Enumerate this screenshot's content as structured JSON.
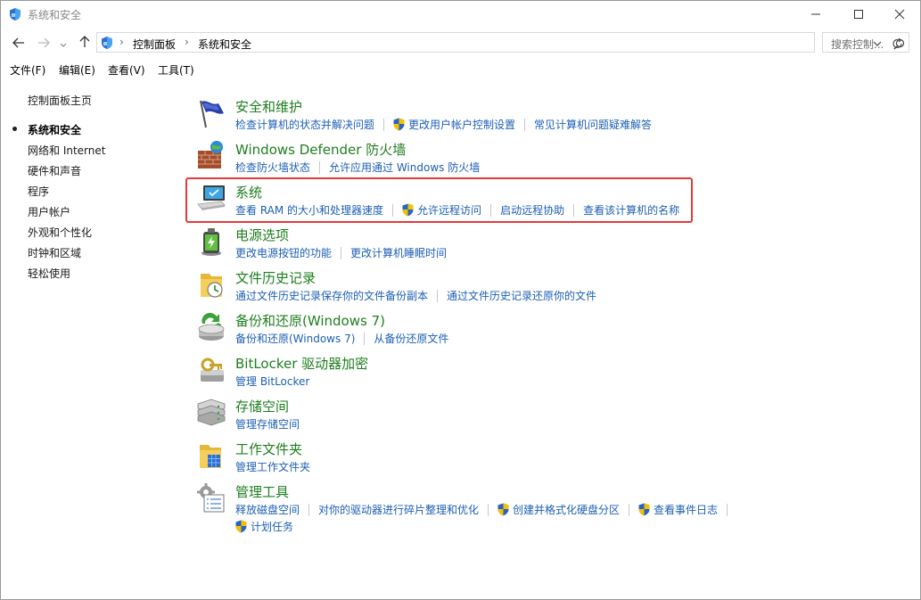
{
  "window": {
    "title": "系统和安全",
    "minimize_icon": "minimize-icon",
    "maximize_icon": "maximize-icon",
    "close_icon": "close-icon"
  },
  "address_bar": {
    "crumbs": [
      "控制面板",
      "系统和安全"
    ],
    "search_placeholder": "搜索控制..."
  },
  "menu": [
    {
      "label": "文件(F)"
    },
    {
      "label": "编辑(E)"
    },
    {
      "label": "查看(V)"
    },
    {
      "label": "工具(T)"
    }
  ],
  "sidebar": {
    "home": "控制面板主页",
    "items": [
      {
        "label": "系统和安全",
        "current": true
      },
      {
        "label": "网络和 Internet"
      },
      {
        "label": "硬件和声音"
      },
      {
        "label": "程序"
      },
      {
        "label": "用户帐户"
      },
      {
        "label": "外观和个性化"
      },
      {
        "label": "时钟和区域"
      },
      {
        "label": "轻松使用"
      }
    ]
  },
  "categories": [
    {
      "title": "安全和维护",
      "icon": "flag-icon",
      "links": [
        {
          "label": "检查计算机的状态并解决问题"
        },
        {
          "label": "更改用户帐户控制设置",
          "shield": true
        },
        {
          "label": "常见计算机问题疑难解答"
        }
      ]
    },
    {
      "title": "Windows Defender 防火墙",
      "icon": "firewall-icon",
      "links": [
        {
          "label": "检查防火墙状态"
        },
        {
          "label": "允许应用通过 Windows 防火墙"
        }
      ]
    },
    {
      "title": "系统",
      "icon": "system-computer-icon",
      "links": [
        {
          "label": "查看 RAM 的大小和处理器速度"
        },
        {
          "label": "允许远程访问",
          "shield": true
        },
        {
          "label": "启动远程协助"
        },
        {
          "label": "查看该计算机的名称"
        }
      ]
    },
    {
      "title": "电源选项",
      "icon": "battery-icon",
      "links": [
        {
          "label": "更改电源按钮的功能"
        },
        {
          "label": "更改计算机睡眠时间"
        }
      ]
    },
    {
      "title": "文件历史记录",
      "icon": "file-history-icon",
      "links": [
        {
          "label": "通过文件历史记录保存你的文件备份副本"
        },
        {
          "label": "通过文件历史记录还原你的文件"
        }
      ]
    },
    {
      "title": "备份和还原(Windows 7)",
      "icon": "backup-restore-icon",
      "links": [
        {
          "label": "备份和还原(Windows 7)"
        },
        {
          "label": "从备份还原文件"
        }
      ]
    },
    {
      "title": "BitLocker 驱动器加密",
      "icon": "bitlocker-icon",
      "links": [
        {
          "label": "管理 BitLocker"
        }
      ]
    },
    {
      "title": "存储空间",
      "icon": "storage-spaces-icon",
      "links": [
        {
          "label": "管理存储空间"
        }
      ]
    },
    {
      "title": "工作文件夹",
      "icon": "work-folders-icon",
      "links": [
        {
          "label": "管理工作文件夹"
        }
      ]
    },
    {
      "title": "管理工具",
      "icon": "admin-tools-icon",
      "links": [
        {
          "label": "释放磁盘空间"
        },
        {
          "label": "对你的驱动器进行碎片整理和优化"
        },
        {
          "label": "创建并格式化硬盘分区",
          "shield": true
        },
        {
          "label": "查看事件日志",
          "shield": true
        }
      ],
      "links_line2": [
        {
          "label": "计划任务",
          "shield": true
        }
      ]
    }
  ],
  "colors": {
    "category_title": "#1e7e1e",
    "link": "#1d5fb4",
    "highlight_border": "#e53a3a"
  }
}
